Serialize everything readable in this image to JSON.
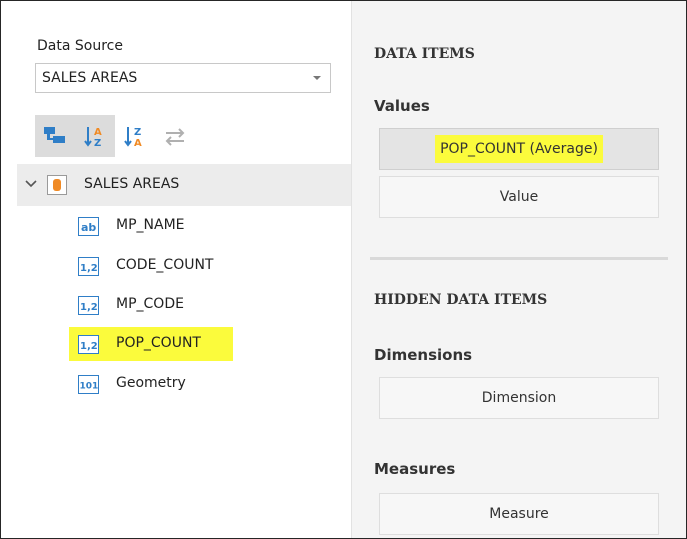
{
  "data_source": {
    "label": "Data Source",
    "selected": "SALES AREAS"
  },
  "toolbar": {
    "buttons": [
      {
        "icon": "hierarchy-icon",
        "active": true
      },
      {
        "icon": "sort-ascending-icon",
        "active": true
      },
      {
        "icon": "sort-descending-icon",
        "active": false
      },
      {
        "icon": "swap-arrows-icon",
        "active": false
      }
    ]
  },
  "tree": {
    "root": {
      "label": "SALES AREAS",
      "icon": "database-icon"
    },
    "fields": [
      {
        "label": "MP_NAME",
        "icon": "text-field-icon",
        "icon_text": "ab"
      },
      {
        "label": "CODE_COUNT",
        "icon": "numeric-field-icon",
        "icon_text": "1,2"
      },
      {
        "label": "MP_CODE",
        "icon": "numeric-field-icon",
        "icon_text": "1,2"
      },
      {
        "label": "POP_COUNT",
        "icon": "numeric-field-icon",
        "icon_text": "1,2",
        "highlighted": true
      },
      {
        "label": "Geometry",
        "icon": "geometry-field-icon",
        "icon_text": "101"
      }
    ]
  },
  "right": {
    "data_items_title": "DATA ITEMS",
    "values_title": "Values",
    "values_filled": "POP_COUNT (Average)",
    "values_placeholder": "Value",
    "hidden_title": "HIDDEN DATA ITEMS",
    "dimensions_title": "Dimensions",
    "dimensions_placeholder": "Dimension",
    "measures_title": "Measures",
    "measures_placeholder": "Measure"
  },
  "colors": {
    "highlight": "#fbfb3c",
    "icon_blue": "#2f7ec7",
    "icon_orange": "#f08a24",
    "active_button_bg": "#dcdcdc",
    "panel_bg": "#f4f4f4"
  }
}
